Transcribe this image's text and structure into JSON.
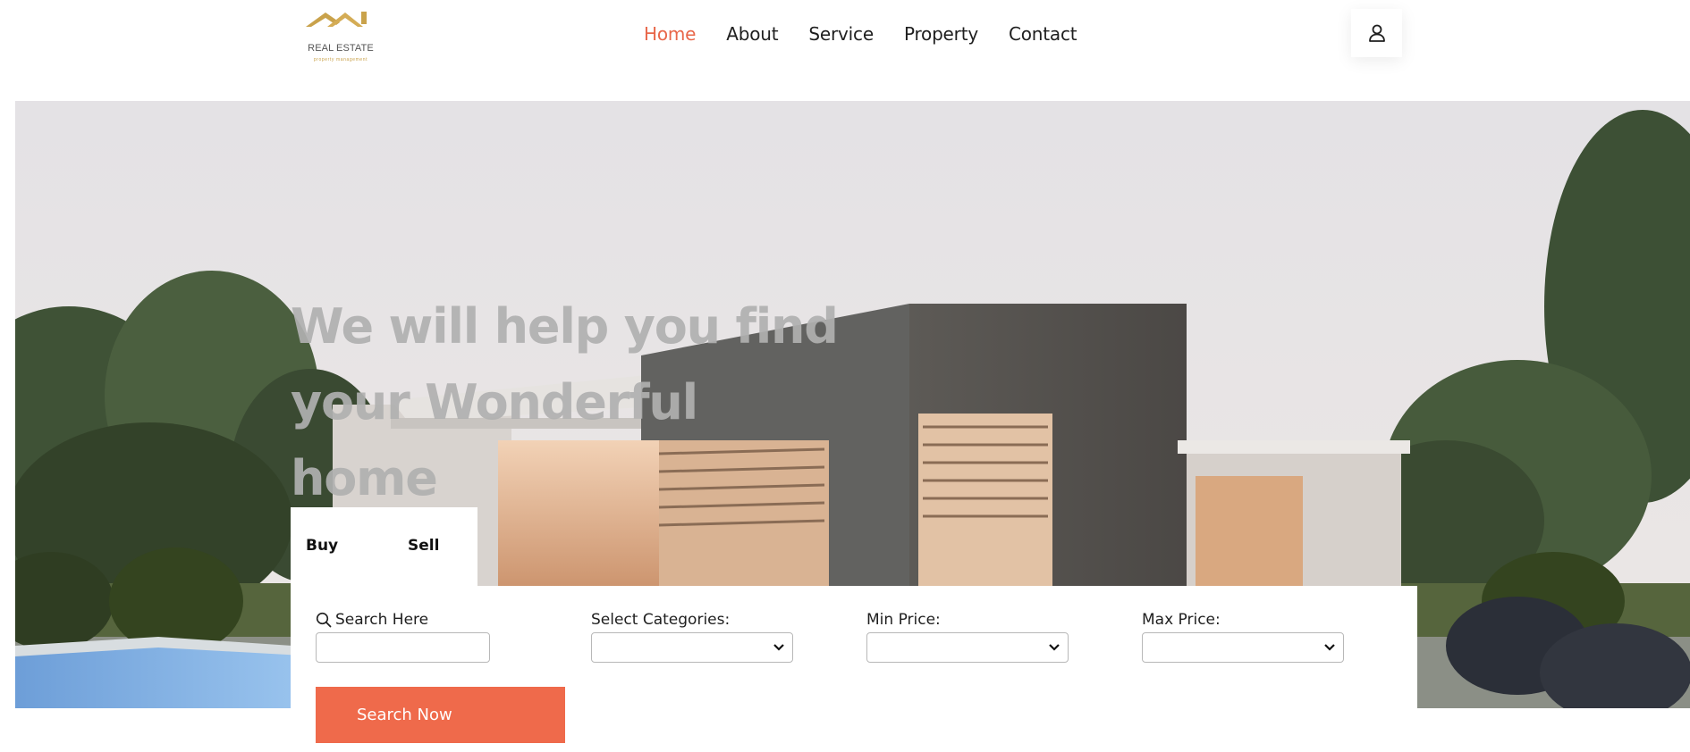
{
  "brand": {
    "name": "REAL ESTATE",
    "tagline": "property management",
    "gold": "#c9a24b"
  },
  "nav": {
    "items": [
      {
        "label": "Home",
        "active": true
      },
      {
        "label": "About",
        "active": false
      },
      {
        "label": "Service",
        "active": false
      },
      {
        "label": "Property",
        "active": false
      },
      {
        "label": "Contact",
        "active": false
      }
    ],
    "active_color": "#e8674a",
    "user_icon": "user-icon"
  },
  "hero": {
    "title": "We will help you find your Wonderful home"
  },
  "search": {
    "tabs": [
      {
        "label": "Buy"
      },
      {
        "label": "Sell"
      }
    ],
    "search_label": "Search Here",
    "search_placeholder": "",
    "categories_label": "Select Categories:",
    "categories_value": "",
    "min_price_label": "Min Price:",
    "min_price_value": "",
    "max_price_label": "Max Price:",
    "max_price_value": "",
    "button_label": "Search Now",
    "accent": "#ef6a4b"
  }
}
